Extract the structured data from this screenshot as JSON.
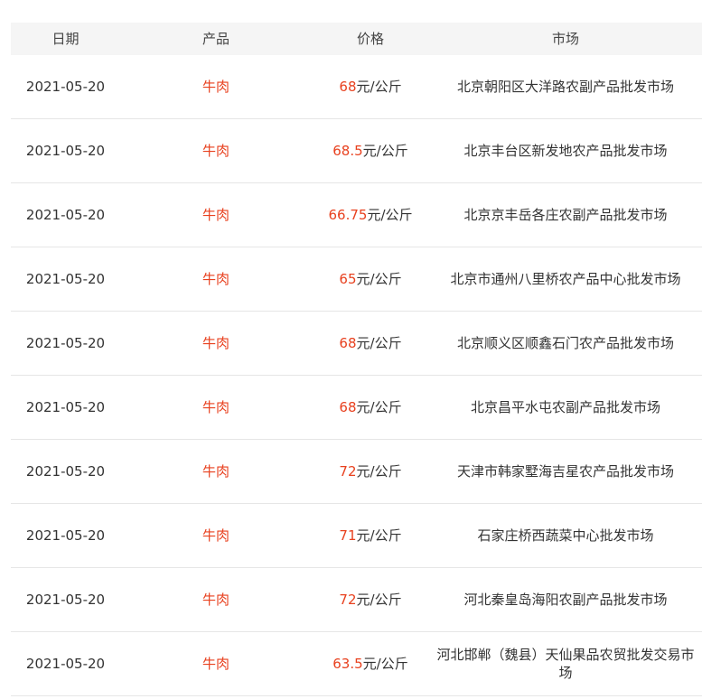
{
  "headers": {
    "date": "日期",
    "product": "产品",
    "price": "价格",
    "market": "市场"
  },
  "accent_color": "#e8411f",
  "rows": [
    {
      "date": "2021-05-20",
      "product": "牛肉",
      "price": "68",
      "unit": "元/公斤",
      "market": "北京朝阳区大洋路农副产品批发市场"
    },
    {
      "date": "2021-05-20",
      "product": "牛肉",
      "price": "68.5",
      "unit": "元/公斤",
      "market": "北京丰台区新发地农产品批发市场"
    },
    {
      "date": "2021-05-20",
      "product": "牛肉",
      "price": "66.75",
      "unit": "元/公斤",
      "market": "北京京丰岳各庄农副产品批发市场"
    },
    {
      "date": "2021-05-20",
      "product": "牛肉",
      "price": "65",
      "unit": "元/公斤",
      "market": "北京市通州八里桥农产品中心批发市场"
    },
    {
      "date": "2021-05-20",
      "product": "牛肉",
      "price": "68",
      "unit": "元/公斤",
      "market": "北京顺义区顺鑫石门农产品批发市场"
    },
    {
      "date": "2021-05-20",
      "product": "牛肉",
      "price": "68",
      "unit": "元/公斤",
      "market": "北京昌平水屯农副产品批发市场"
    },
    {
      "date": "2021-05-20",
      "product": "牛肉",
      "price": "72",
      "unit": "元/公斤",
      "market": "天津市韩家墅海吉星农产品批发市场"
    },
    {
      "date": "2021-05-20",
      "product": "牛肉",
      "price": "71",
      "unit": "元/公斤",
      "market": "石家庄桥西蔬菜中心批发市场"
    },
    {
      "date": "2021-05-20",
      "product": "牛肉",
      "price": "72",
      "unit": "元/公斤",
      "market": "河北秦皇岛海阳农副产品批发市场"
    },
    {
      "date": "2021-05-20",
      "product": "牛肉",
      "price": "63.5",
      "unit": "元/公斤",
      "market": "河北邯郸（魏县）天仙果品农贸批发交易市场"
    }
  ]
}
